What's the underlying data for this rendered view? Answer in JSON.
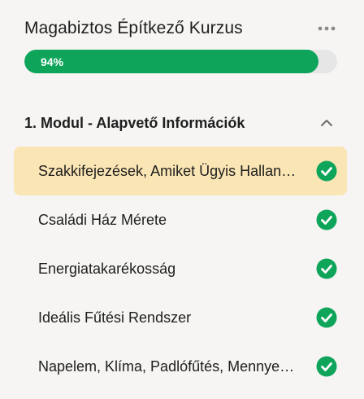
{
  "course": {
    "title": "Magabiztos Építkező Kurzus",
    "menu_icon": "more-horizontal-icon"
  },
  "progress": {
    "percent": 94,
    "label": "94%",
    "color": "#0ea45a"
  },
  "module": {
    "title": "1. Modul - Alapvető Információk",
    "expanded": true,
    "toggle_icon": "chevron-up-icon"
  },
  "lessons": [
    {
      "label": "Szakkifejezések, Amiket Ügyis Hallani Fogsz",
      "completed": true,
      "active": true
    },
    {
      "label": "Családi Ház Mérete",
      "completed": true,
      "active": false
    },
    {
      "label": "Energiatakarékosság",
      "completed": true,
      "active": false
    },
    {
      "label": "Ideális Fűtési Rendszer",
      "completed": true,
      "active": false
    },
    {
      "label": "Napelem, Klíma, Padlófűtés, Mennyezethűtés",
      "completed": true,
      "active": false
    }
  ],
  "colors": {
    "background": "#f6f5f3",
    "accent": "#0ea45a",
    "active_row": "#fae5b4"
  }
}
